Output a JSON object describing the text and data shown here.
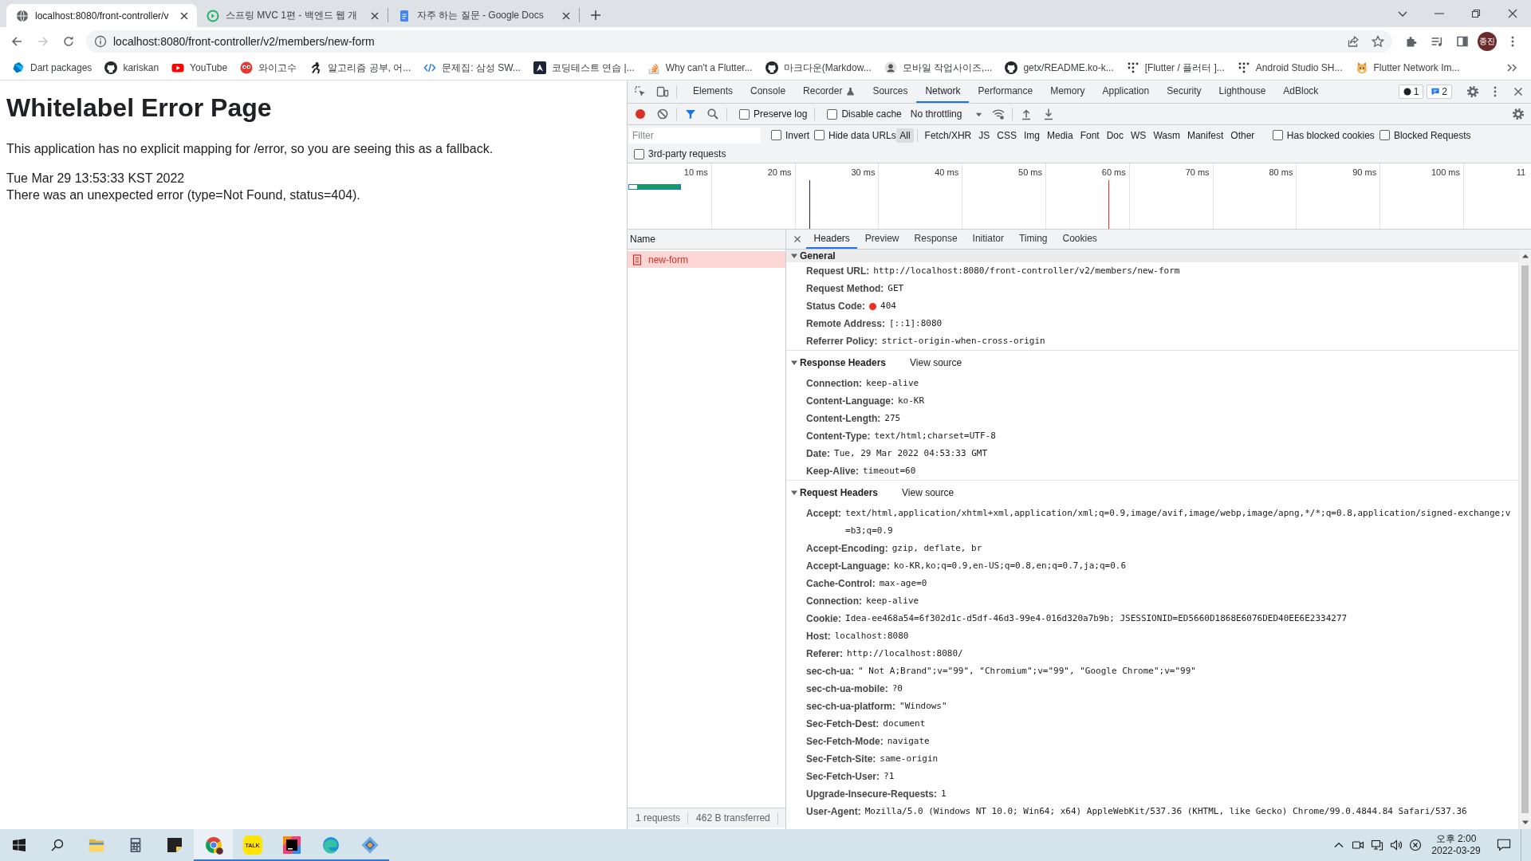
{
  "browser": {
    "tabs": [
      {
        "kind": "globe",
        "title": "localhost:8080/front-controller/v",
        "selected": true
      },
      {
        "kind": "course",
        "title": "스프링 MVC 1편 - 백엔드 웹 개",
        "selected": false
      },
      {
        "kind": "docs",
        "title": "자주 하는 질문 - Google Docs",
        "selected": false
      }
    ],
    "back_enabled": true,
    "forward_enabled": false,
    "url": "localhost:8080/front-controller/v2/members/new-form",
    "profile": "종진",
    "bookmarks": [
      {
        "kind": "dart",
        "label": "Dart packages"
      },
      {
        "kind": "github",
        "label": "kariskan"
      },
      {
        "kind": "youtube",
        "label": "YouTube"
      },
      {
        "kind": "eyes",
        "label": "와이고수"
      },
      {
        "kind": "figure",
        "label": "알고리즘 공부, 어..."
      },
      {
        "kind": "code",
        "label": "문제집: 삼성 SW..."
      },
      {
        "kind": "square",
        "label": "코딩테스트 연습 |..."
      },
      {
        "kind": "stack",
        "label": "Why can't a Flutter..."
      },
      {
        "kind": "github",
        "label": "마크다운(Markdow..."
      },
      {
        "kind": "avatar",
        "label": "모바일 작업사이즈,..."
      },
      {
        "kind": "github",
        "label": "getx/README.ko-k..."
      },
      {
        "kind": "dots",
        "label": "[Flutter / 플러터 ]..."
      },
      {
        "kind": "dots",
        "label": "Android Studio SH..."
      },
      {
        "kind": "dog",
        "label": "Flutter Network Im..."
      }
    ]
  },
  "page": {
    "heading": "Whitelabel Error Page",
    "message": "This application has no explicit mapping for /error, so you are seeing this as a fallback.",
    "timestamp": "Tue Mar 29 13:53:33 KST 2022",
    "error": "There was an unexpected error (type=Not Found, status=404)."
  },
  "devtools": {
    "tabs": [
      {
        "label": "Elements",
        "selected": false,
        "experimental": false
      },
      {
        "label": "Console",
        "selected": false,
        "experimental": false
      },
      {
        "label": "Recorder",
        "selected": false,
        "experimental": true
      },
      {
        "label": "Sources",
        "selected": false,
        "experimental": false
      },
      {
        "label": "Network",
        "selected": true,
        "experimental": false
      },
      {
        "label": "Performance",
        "selected": false,
        "experimental": false
      },
      {
        "label": "Memory",
        "selected": false,
        "experimental": false
      },
      {
        "label": "Application",
        "selected": false,
        "experimental": false
      },
      {
        "label": "Security",
        "selected": false,
        "experimental": false
      },
      {
        "label": "Lighthouse",
        "selected": false,
        "experimental": false
      },
      {
        "label": "AdBlock",
        "selected": false,
        "experimental": false
      }
    ],
    "badges": [
      {
        "kind": "errors",
        "count": "1"
      },
      {
        "kind": "messages",
        "count": "2"
      }
    ],
    "recording": true,
    "filter_shown": true,
    "toolbar_checks": [
      {
        "label": "Preserve log",
        "checked": false
      },
      {
        "label": "Disable cache",
        "checked": false
      }
    ],
    "throttling": "No throttling",
    "filter": {
      "placeholder": "Filter",
      "checks": [
        {
          "label": "Invert",
          "checked": false
        },
        {
          "label": "Hide data URLs",
          "checked": false
        }
      ],
      "types": [
        {
          "label": "All",
          "selected": true
        },
        {
          "label": "Fetch/XHR",
          "selected": false
        },
        {
          "label": "JS",
          "selected": false
        },
        {
          "label": "CSS",
          "selected": false
        },
        {
          "label": "Img",
          "selected": false
        },
        {
          "label": "Media",
          "selected": false
        },
        {
          "label": "Font",
          "selected": false
        },
        {
          "label": "Doc",
          "selected": false
        },
        {
          "label": "WS",
          "selected": false
        },
        {
          "label": "Wasm",
          "selected": false
        },
        {
          "label": "Manifest",
          "selected": false
        },
        {
          "label": "Other",
          "selected": false
        }
      ],
      "blocked_checks": [
        {
          "label": "Has blocked cookies",
          "checked": false
        },
        {
          "label": "Blocked Requests",
          "checked": false
        }
      ],
      "third_party": {
        "label": "3rd-party requests",
        "checked": false
      }
    },
    "overview_ticks": [
      "10 ms",
      "20 ms",
      "30 ms",
      "40 ms",
      "50 ms",
      "60 ms",
      "70 ms",
      "80 ms",
      "90 ms",
      "100 ms",
      "11"
    ],
    "name_column": "Name",
    "requests": [
      {
        "name": "new-form",
        "selected": true,
        "failed": true
      }
    ],
    "summary": [
      "1 requests",
      "462 B transferred"
    ],
    "detail_tabs": [
      {
        "label": "Headers",
        "selected": true
      },
      {
        "label": "Preview",
        "selected": false
      },
      {
        "label": "Response",
        "selected": false
      },
      {
        "label": "Initiator",
        "selected": false
      },
      {
        "label": "Timing",
        "selected": false
      },
      {
        "label": "Cookies",
        "selected": false
      }
    ],
    "sections": [
      {
        "title": "General",
        "expanded": true,
        "focused": true,
        "rows": [
          {
            "name": "Request URL:",
            "value": "http://localhost:8080/front-controller/v2/members/new-form"
          },
          {
            "name": "Request Method:",
            "value": "GET"
          },
          {
            "name": "Status Code:",
            "value": "404",
            "color": "#e8312a"
          },
          {
            "name": "Remote Address:",
            "value": "[::1]:8080"
          },
          {
            "name": "Referrer Policy:",
            "value": "strict-origin-when-cross-origin"
          }
        ]
      },
      {
        "title": "Response Headers",
        "expanded": true,
        "focused": false,
        "action": "View source",
        "rows": [
          {
            "name": "Connection:",
            "value": "keep-alive"
          },
          {
            "name": "Content-Language:",
            "value": "ko-KR"
          },
          {
            "name": "Content-Length:",
            "value": "275"
          },
          {
            "name": "Content-Type:",
            "value": "text/html;charset=UTF-8"
          },
          {
            "name": "Date:",
            "value": "Tue, 29 Mar 2022 04:53:33 GMT"
          },
          {
            "name": "Keep-Alive:",
            "value": "timeout=60"
          }
        ]
      },
      {
        "title": "Request Headers",
        "expanded": true,
        "focused": false,
        "action": "View source",
        "rows": [
          {
            "name": "Accept:",
            "value": "text/html,application/xhtml+xml,application/xml;q=0.9,image/avif,image/webp,image/apng,*/*;q=0.8,application/signed-exchange;v=b3;q=0.9"
          },
          {
            "name": "Accept-Encoding:",
            "value": "gzip, deflate, br"
          },
          {
            "name": "Accept-Language:",
            "value": "ko-KR,ko;q=0.9,en-US;q=0.8,en;q=0.7,ja;q=0.6"
          },
          {
            "name": "Cache-Control:",
            "value": "max-age=0"
          },
          {
            "name": "Connection:",
            "value": "keep-alive"
          },
          {
            "name": "Cookie:",
            "value": "Idea-ee468a54=6f302d1c-d5df-46d3-99e4-016d320a7b9b; JSESSIONID=ED5660D1868E6076DED40EE6E2334277"
          },
          {
            "name": "Host:",
            "value": "localhost:8080"
          },
          {
            "name": "Referer:",
            "value": "http://localhost:8080/"
          },
          {
            "name": "sec-ch-ua:",
            "value": "\" Not A;Brand\";v=\"99\", \"Chromium\";v=\"99\", \"Google Chrome\";v=\"99\""
          },
          {
            "name": "sec-ch-ua-mobile:",
            "value": "?0"
          },
          {
            "name": "sec-ch-ua-platform:",
            "value": "\"Windows\""
          },
          {
            "name": "Sec-Fetch-Dest:",
            "value": "document"
          },
          {
            "name": "Sec-Fetch-Mode:",
            "value": "navigate"
          },
          {
            "name": "Sec-Fetch-Site:",
            "value": "same-origin"
          },
          {
            "name": "Sec-Fetch-User:",
            "value": "?1"
          },
          {
            "name": "Upgrade-Insecure-Requests:",
            "value": "1"
          },
          {
            "name": "User-Agent:",
            "value": "Mozilla/5.0 (Windows NT 10.0; Win64; x64) AppleWebKit/537.36 (KHTML, like Gecko) Chrome/99.0.4844.84 Safari/537.36"
          }
        ]
      }
    ]
  },
  "taskbar": {
    "apps": [
      {
        "kind": "folder",
        "running": false,
        "selected": false
      },
      {
        "kind": "calculator",
        "running": false,
        "selected": false
      },
      {
        "kind": "notes",
        "running": false,
        "selected": false
      },
      {
        "kind": "ring",
        "running": true,
        "selected": true
      },
      {
        "kind": "chat",
        "running": true,
        "selected": false,
        "label": "TALK"
      },
      {
        "kind": "ide",
        "running": true,
        "selected": false
      },
      {
        "kind": "swirl",
        "running": true,
        "selected": false
      },
      {
        "kind": "diamond",
        "running": true,
        "selected": false
      }
    ],
    "time": "오후 2:00",
    "date": "2022-03-29"
  }
}
